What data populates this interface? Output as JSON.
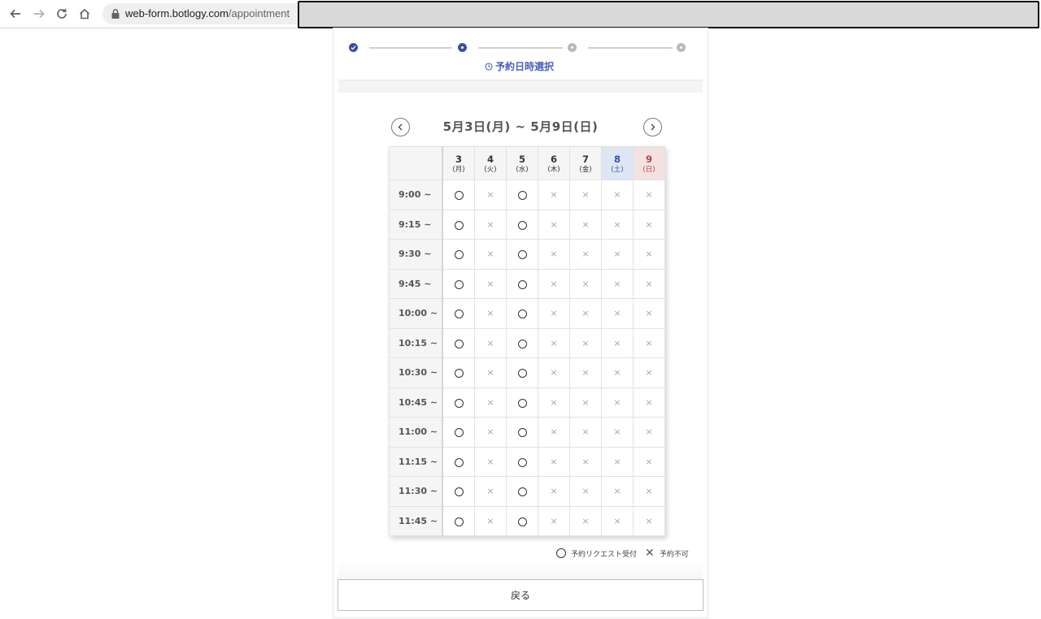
{
  "browser": {
    "url_host": "web-form.botlogy.com",
    "url_path": "/appointment"
  },
  "stepper": {
    "current_label": "予約日時選択",
    "steps": [
      "done",
      "current",
      "todo",
      "todo"
    ]
  },
  "calendar": {
    "range_label": "5月3日(月) ~ 5月9日(日)",
    "days": [
      {
        "num": "3",
        "weekday": "(月)",
        "kind": "weekday"
      },
      {
        "num": "4",
        "weekday": "(火)",
        "kind": "weekday"
      },
      {
        "num": "5",
        "weekday": "(水)",
        "kind": "weekday"
      },
      {
        "num": "6",
        "weekday": "(木)",
        "kind": "weekday"
      },
      {
        "num": "7",
        "weekday": "(金)",
        "kind": "weekday"
      },
      {
        "num": "8",
        "weekday": "(土)",
        "kind": "saturday"
      },
      {
        "num": "9",
        "weekday": "(日)",
        "kind": "sunday"
      }
    ],
    "rows": [
      {
        "time": "9:00 ~",
        "slots": [
          "open",
          "closed",
          "open",
          "closed",
          "closed",
          "closed",
          "closed"
        ]
      },
      {
        "time": "9:15 ~",
        "slots": [
          "open",
          "closed",
          "open",
          "closed",
          "closed",
          "closed",
          "closed"
        ]
      },
      {
        "time": "9:30 ~",
        "slots": [
          "open",
          "closed",
          "open",
          "closed",
          "closed",
          "closed",
          "closed"
        ]
      },
      {
        "time": "9:45 ~",
        "slots": [
          "open",
          "closed",
          "open",
          "closed",
          "closed",
          "closed",
          "closed"
        ]
      },
      {
        "time": "10:00 ~",
        "slots": [
          "open",
          "closed",
          "open",
          "closed",
          "closed",
          "closed",
          "closed"
        ]
      },
      {
        "time": "10:15 ~",
        "slots": [
          "open",
          "closed",
          "open",
          "closed",
          "closed",
          "closed",
          "closed"
        ]
      },
      {
        "time": "10:30 ~",
        "slots": [
          "open",
          "closed",
          "open",
          "closed",
          "closed",
          "closed",
          "closed"
        ]
      },
      {
        "time": "10:45 ~",
        "slots": [
          "open",
          "closed",
          "open",
          "closed",
          "closed",
          "closed",
          "closed"
        ]
      },
      {
        "time": "11:00 ~",
        "slots": [
          "open",
          "closed",
          "open",
          "closed",
          "closed",
          "closed",
          "closed"
        ]
      },
      {
        "time": "11:15 ~",
        "slots": [
          "open",
          "closed",
          "open",
          "closed",
          "closed",
          "closed",
          "closed"
        ]
      },
      {
        "time": "11:30 ~",
        "slots": [
          "open",
          "closed",
          "open",
          "closed",
          "closed",
          "closed",
          "closed"
        ]
      },
      {
        "time": "11:45 ~",
        "slots": [
          "open",
          "closed",
          "open",
          "closed",
          "closed",
          "closed",
          "closed"
        ]
      }
    ],
    "closed_symbol": "×"
  },
  "legend": {
    "open_label": "予約リクエスト受付",
    "closed_symbol": "✕",
    "closed_label": "予約不可"
  },
  "actions": {
    "back_label": "戻る"
  },
  "colors": {
    "accent": "#3a4fa8",
    "saturday_bg": "#dde6f3",
    "sunday_bg": "#f3e2e2"
  }
}
